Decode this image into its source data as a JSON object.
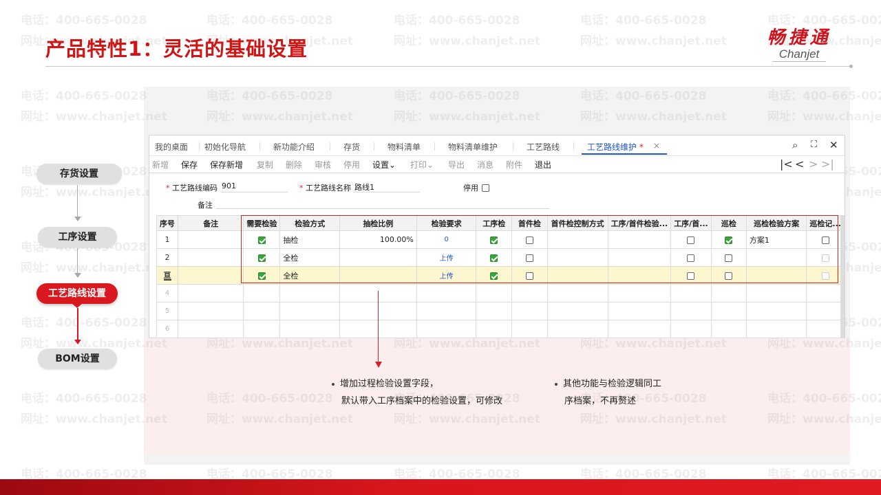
{
  "slide": {
    "title": "产品特性1：灵活的基础设置",
    "logo_cn": "畅捷通",
    "logo_en": "Chanjet",
    "accent_color": "#d9181f"
  },
  "watermark": {
    "phone": "电话：400-665-0028",
    "site": "网址：www.chanjet.net"
  },
  "steps": [
    {
      "label": "存货设置",
      "active": false
    },
    {
      "label": "工序设置",
      "active": false
    },
    {
      "label": "工艺路线设置",
      "active": true
    },
    {
      "label": "BOM设置",
      "active": false
    }
  ],
  "app": {
    "tabs": [
      "我的桌面",
      "初始化导航",
      "新功能介绍",
      "存货",
      "物料清单",
      "物料清单维护",
      "工艺路线"
    ],
    "active_tab": "工艺路线维护",
    "active_tab_mark": "*",
    "tab_close": "×",
    "window_controls": {
      "search": "⌕",
      "fullscreen": "⛶",
      "close": "✕"
    },
    "toolbar": {
      "new": "新增",
      "save": "保存",
      "save_new": "保存新增",
      "copy": "复制",
      "delete": "删除",
      "audit": "审核",
      "disable": "停用",
      "settings": "设置",
      "settings_caret": "⌄",
      "print": "打印",
      "print_caret": "⌄",
      "export": "导出",
      "message": "消息",
      "attachment": "附件",
      "exit": "退出"
    },
    "pager": {
      "first": "|<",
      "prev": "<",
      "next": ">",
      "last": ">|"
    },
    "form": {
      "code_label": "工艺路线编码",
      "code_value": "901",
      "name_label": "工艺路线名称",
      "name_value": "路线1",
      "disable_label": "停用",
      "remark_label": "备注",
      "required_mark": "*"
    },
    "grid": {
      "headers": [
        "序号",
        "备注",
        "需要检验",
        "检验方式",
        "抽检比例",
        "检验要求",
        "工序检",
        "首件检",
        "首件检控制方式",
        "工序/首件检验...",
        "工序/首...",
        "巡检",
        "巡检检验方案",
        "巡检记..."
      ],
      "rows": [
        {
          "no": "1",
          "remark": "",
          "need_check": true,
          "method": "抽检",
          "ratio": "100.00%",
          "req": "0",
          "proc_check": true,
          "first_check": false,
          "first_ctrl": "",
          "first_scheme": "",
          "proc_first": false,
          "patrol": true,
          "patrol_scheme": "方案1",
          "patrol_rec": false
        },
        {
          "no": "2",
          "remark": "",
          "need_check": true,
          "method": "全检",
          "ratio": "",
          "req": "上传",
          "proc_check": true,
          "first_check": false,
          "first_ctrl": "",
          "first_scheme": "",
          "proc_first": false,
          "patrol": false,
          "patrol_scheme": "",
          "patrol_rec": false
        },
        {
          "no": "亘",
          "remark": "",
          "need_check": true,
          "method": "全检",
          "ratio": "",
          "req": "上传",
          "proc_check": true,
          "first_check": false,
          "first_ctrl": "",
          "first_scheme": "",
          "proc_first": false,
          "patrol": false,
          "patrol_scheme": "",
          "patrol_rec": false
        },
        {
          "no": "4"
        },
        {
          "no": "5"
        },
        {
          "no": "6"
        }
      ]
    }
  },
  "notes": {
    "left_line1": "增加过程检验设置字段，",
    "left_line2": "默认带入工序档案中的检验设置，可修改",
    "right_line1": "其他功能与检验逻辑同工",
    "right_line2": "序档案，不再赘述"
  }
}
